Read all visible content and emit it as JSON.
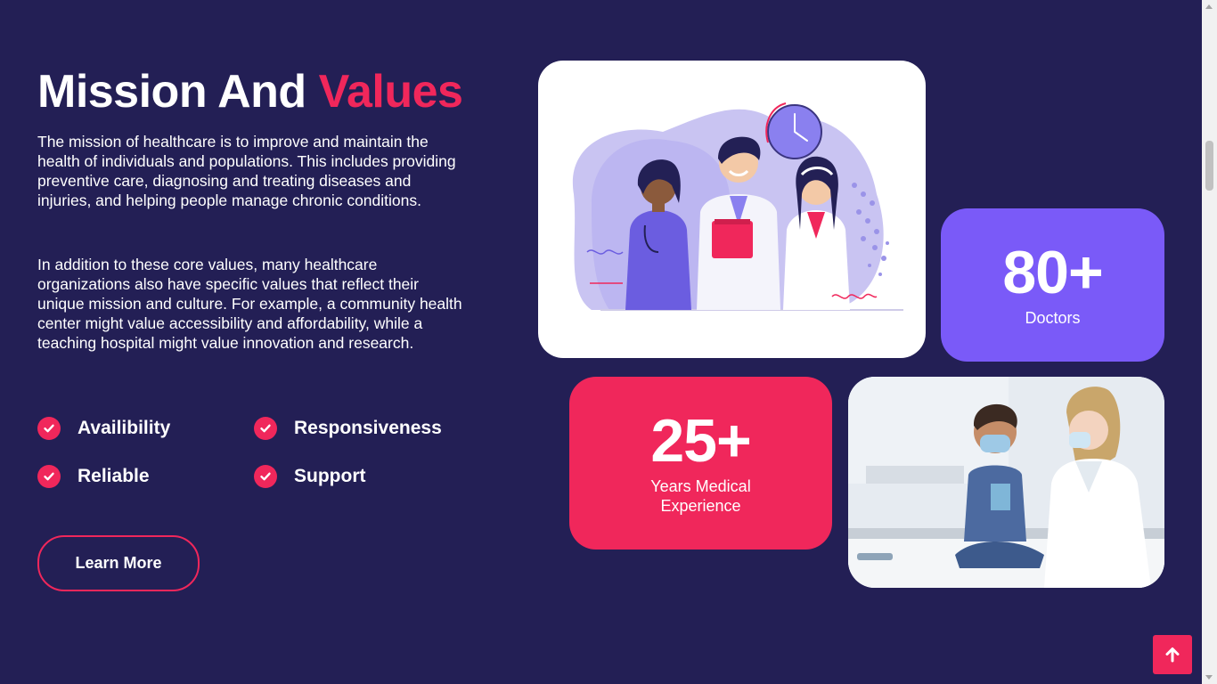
{
  "section": {
    "title_main": "Mission And",
    "title_accent": "Values",
    "paragraph_1": "The mission of healthcare is to improve and maintain the health of individuals and populations. This includes providing preventive care, diagnosing and treating diseases and injuries, and helping people manage chronic conditions.",
    "paragraph_2": "In addition to these core values, many healthcare organizations also have specific values that reflect their unique mission and culture. For example, a community health center might value accessibility and affordability, while a teaching hospital might value innovation and research.",
    "values": [
      {
        "label": "Availibility"
      },
      {
        "label": "Responsiveness"
      },
      {
        "label": "Reliable"
      },
      {
        "label": "Support"
      }
    ],
    "cta_label": "Learn More"
  },
  "stats": {
    "doctors": {
      "number": "80+",
      "label": "Doctors"
    },
    "experience": {
      "number": "25+",
      "label": "Years Medical Experience"
    }
  },
  "icons": {
    "value_check": "check-circle-icon",
    "back_to_top": "arrow-up-icon"
  },
  "colors": {
    "background": "#231f55",
    "accent_pink": "#f0275b",
    "accent_purple": "#7a5af8",
    "text": "#ffffff"
  }
}
